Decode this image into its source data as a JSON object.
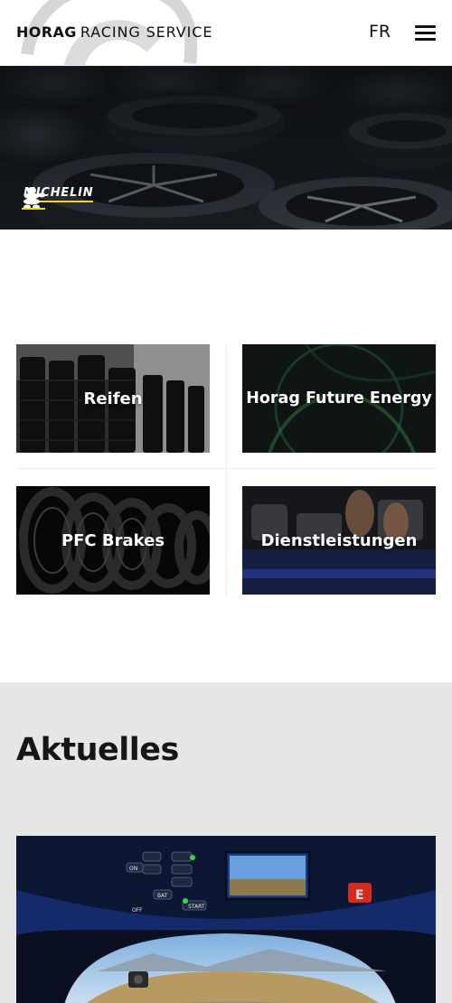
{
  "header": {
    "logo_primary": "HORAG",
    "logo_secondary": "RACING SERVICE",
    "language": "FR",
    "menu_icon": "hamburger-menu-icon"
  },
  "hero": {
    "brand": "MICHELIN",
    "brand_icon": "michelin-man-icon",
    "accent_color": "#f2d22c"
  },
  "categories": [
    {
      "label": "Reifen"
    },
    {
      "label": "Horag Future Energy"
    },
    {
      "label": "PFC Brakes"
    },
    {
      "label": "Dienstleistungen"
    }
  ],
  "news": {
    "title": "Aktuelles",
    "background_color": "#e6e6e6",
    "card": {
      "dash_labels": [
        "ON",
        "OFF",
        "BAT",
        "START",
        "E"
      ]
    }
  }
}
